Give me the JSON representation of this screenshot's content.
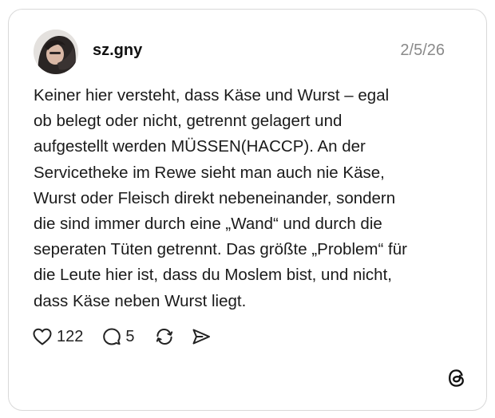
{
  "post": {
    "username": "sz.gny",
    "date": "2/5/26",
    "body_lines": [
      "Keiner hier versteht, dass Käse und Wurst – egal",
      "ob belegt oder nicht, getrennt gelagert und",
      "aufgestellt werden MÜSSEN(HACCP). An der",
      "Servicetheke im Rewe sieht man auch nie Käse,",
      "Wurst oder Fleisch direkt nebeneinander, sondern",
      "die sind immer durch eine „Wand“ und durch die",
      "seperaten Tüten getrennt. Das größte „Problem“ für",
      "die Leute hier ist, dass du Moslem bist, und nicht,",
      "dass Käse neben Wurst liegt."
    ]
  },
  "actions": {
    "like_count": "122",
    "reply_count": "5"
  },
  "icons": {
    "like": "heart-icon",
    "reply": "speech-bubble-icon",
    "repost": "repost-icon",
    "share": "send-icon",
    "brand": "threads-logo-icon"
  },
  "colors": {
    "text": "#1a1a1a",
    "date": "#8a8a8a",
    "border": "#d9d9d9"
  }
}
